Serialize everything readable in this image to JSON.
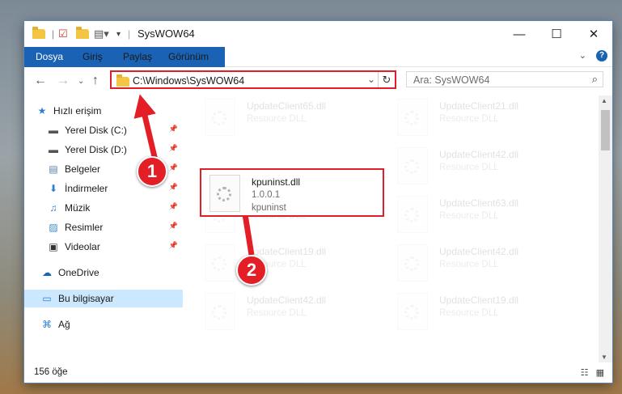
{
  "window": {
    "title": "SysWOW64"
  },
  "window_controls": {
    "minimize": "—",
    "maximize": "☐",
    "close": "✕"
  },
  "ribbon": {
    "tabs": [
      "Dosya",
      "Giriş",
      "Paylaş",
      "Görünüm"
    ]
  },
  "address_bar": {
    "path": "C:\\Windows\\SysWOW64"
  },
  "search": {
    "placeholder": "Ara: SysWOW64"
  },
  "sidebar": {
    "items": [
      {
        "label": "Hızlı erişim",
        "icon": "star-icon",
        "pinned": false
      },
      {
        "label": "Yerel Disk (C:)",
        "icon": "drive-icon",
        "pinned": true
      },
      {
        "label": "Yerel Disk (D:)",
        "icon": "drive-icon",
        "pinned": true
      },
      {
        "label": "Belgeler",
        "icon": "documents-icon",
        "pinned": true
      },
      {
        "label": "İndirmeler",
        "icon": "download-icon",
        "pinned": true
      },
      {
        "label": "Müzik",
        "icon": "music-icon",
        "pinned": true
      },
      {
        "label": "Resimler",
        "icon": "pictures-icon",
        "pinned": true
      },
      {
        "label": "Videolar",
        "icon": "videos-icon",
        "pinned": true
      },
      {
        "label": "OneDrive",
        "icon": "cloud-icon",
        "pinned": false
      },
      {
        "label": "Bu bilgisayar",
        "icon": "computer-icon",
        "pinned": false,
        "selected": true
      },
      {
        "label": "Ağ",
        "icon": "network-icon",
        "pinned": false
      }
    ]
  },
  "files": {
    "left": [
      {
        "name": "UpdateClient65.dll",
        "desc": "Resource DLL"
      },
      {
        "name": "kpuninst.dll",
        "version": "1.0.0.1",
        "desc": "kpuninst",
        "highlighted": true
      },
      {
        "name": "UpdateClient42.dll",
        "desc": "Resource DLL"
      },
      {
        "name": "UpdateClient19.dll",
        "desc": "Resource DLL"
      },
      {
        "name": "UpdateClient42.dll",
        "desc": "Resource DLL"
      }
    ],
    "right": [
      {
        "name": "UpdateClient21.dll",
        "desc": "Resource DLL"
      },
      {
        "name": "UpdateClient42.dll",
        "desc": "Resource DLL"
      },
      {
        "name": "UpdateClient63.dll",
        "desc": "Resource DLL"
      },
      {
        "name": "UpdateClient42.dll",
        "desc": "Resource DLL"
      },
      {
        "name": "UpdateClient19.dll",
        "desc": "Resource DLL"
      }
    ]
  },
  "status": {
    "item_count": "156 öğe"
  },
  "callouts": [
    "1",
    "2"
  ],
  "colors": {
    "accent": "#1a62b4",
    "highlight": "#e01e27",
    "selection": "#cce8ff"
  }
}
